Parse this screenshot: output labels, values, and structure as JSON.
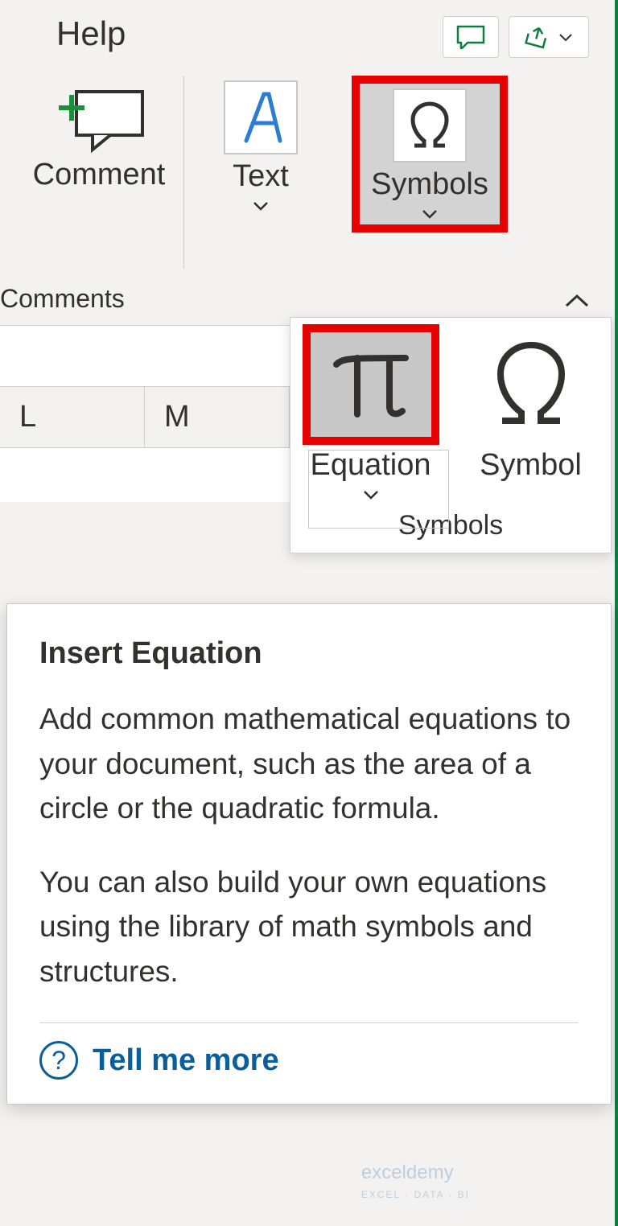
{
  "tabs": {
    "help": "Help"
  },
  "ribbon": {
    "comment": {
      "label": "Comment",
      "group": "Comments"
    },
    "text": {
      "label": "Text"
    },
    "symbols": {
      "label": "Symbols"
    }
  },
  "columns": {
    "l": "L",
    "m": "M"
  },
  "dropdown": {
    "equation": "Equation",
    "symbol": "Symbol",
    "group": "Symbols"
  },
  "tooltip": {
    "title": "Insert Equation",
    "p1": "Add common mathematical equations to your document, such as the area of a circle or the quadratic formula.",
    "p2": "You can also build your own equations using the library of math symbols and structures.",
    "more": "Tell me more"
  },
  "watermark": {
    "brand": "exceldemy",
    "tag": "EXCEL · DATA · BI"
  }
}
